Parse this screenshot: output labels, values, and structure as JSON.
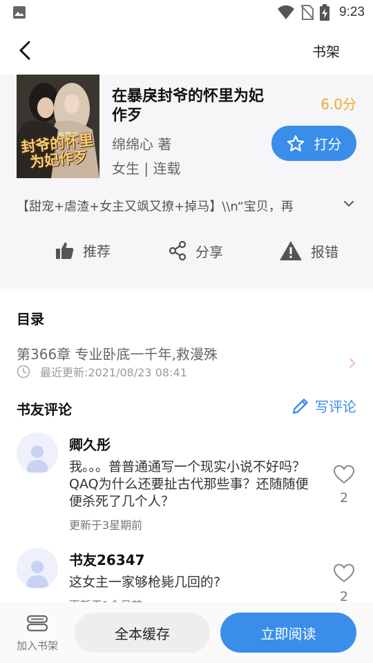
{
  "status_bar": {
    "time": "9:23"
  },
  "app_bar": {
    "shelf_label": "书架"
  },
  "book": {
    "title": "在暴戾封爷的怀里为妃作歹",
    "author": "绵绵心 著",
    "meta": "女生 | 连载",
    "score": "6.0分",
    "rate_label": "打分",
    "cover_text": {
      "small": "在暴戾",
      "main": "封爷的怀里为妃作歹"
    },
    "synopsis": "【甜宠+虐渣+女主又飒又撩+掉马】\\\\n“宝贝，再"
  },
  "actions": {
    "recommend": "推荐",
    "share": "分享",
    "report": "报错"
  },
  "toc": {
    "title": "目录",
    "latest_chapter": "第366章 专业卧底一千年,救漫殊",
    "updated": "最近更新:2021/08/23 08:41"
  },
  "reviews": {
    "title": "书友评论",
    "write_label": "写评论",
    "items": [
      {
        "name": "卿久彤",
        "text": "我。。。普普通通写一个现实小说不好吗？QAQ为什么还要扯古代那些事？还随随便便杀死了几个人？",
        "time": "更新于3星期前",
        "likes": "2"
      },
      {
        "name": "书友26347",
        "text": "这女主一家够枪毙几回的?",
        "time": "更新于1个月前",
        "likes": "2"
      }
    ]
  },
  "bottom_bar": {
    "add_shelf": "加入书架",
    "cache_all": "全本缓存",
    "read_now": "立即阅读"
  },
  "colors": {
    "accent": "#3a8eea",
    "score": "#f5a623"
  }
}
